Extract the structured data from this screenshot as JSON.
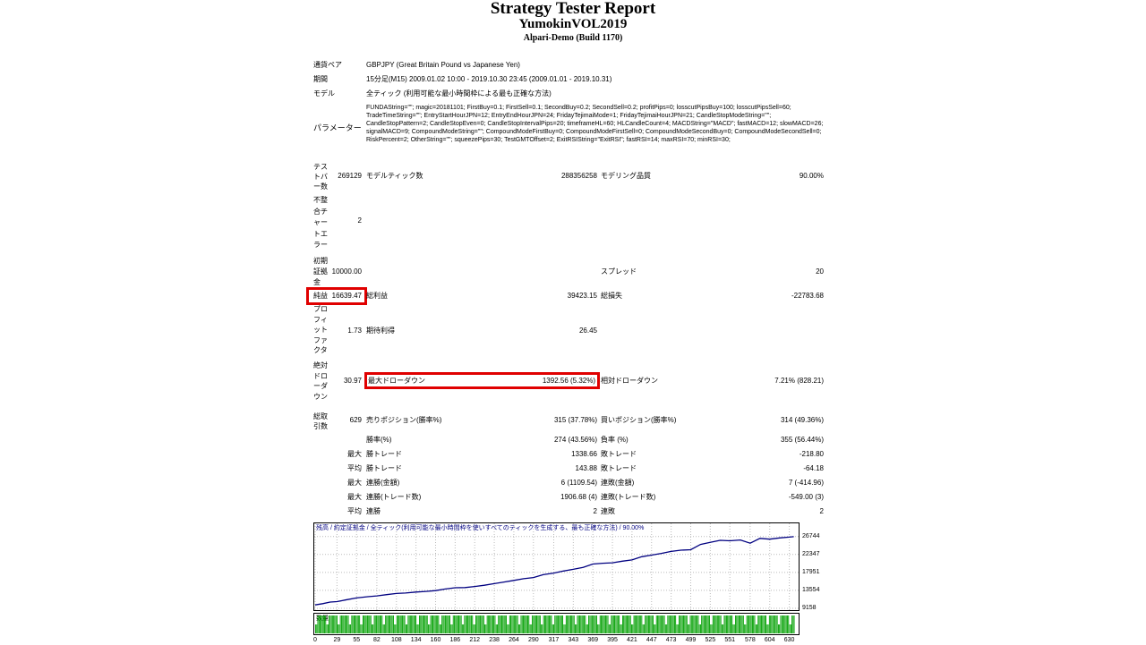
{
  "report": {
    "title": "Strategy Tester Report",
    "ea_name": "YumokinVOL2019",
    "server": "Alpari-Demo (Build 1170)"
  },
  "info": {
    "symbol_label": "通貨ペア",
    "symbol_value": "GBPJPY (Great Britain Pound vs Japanese Yen)",
    "period_label": "期間",
    "period_value": "15分足(M15) 2009.01.02 10:00 - 2019.10.30 23:45 (2009.01.01 - 2019.10.31)",
    "model_label": "モデル",
    "model_value": "全ティック (利用可能な最小時間枠による最も正確な方法)",
    "params_label": "パラメーター",
    "params_value": "FUNDAString=\"\"; magic=20181101; FirstBuy=0.1; FirstSell=0.1; SecondBuy=0.2; SecondSell=0.2; profitPips=0; losscutPipsBuy=100; losscutPipsSell=60; TradeTimeString=\"\"; EntryStartHourJPN=12; EntryEndHourJPN=24; FridayTejimaiMode=1; FridayTejimaiHourJPN=21; CandleStopModeString=\"\"; CandleStopPattern=2; CandleStopEven=0; CandleStopIntervalPips=20; timeframeHL=60; HLCandleCount=4; MACDString=\"MACD\"; fastMACD=12; slowMACD=26; signalMACD=9; CompoundModeString=\"\"; CompoundModeFirstBuy=0; CompoundModeFirstSell=0; CompoundModeSecondBuy=0; CompoundModeSecondSell=0; RiskPercent=2; OtherString=\"\"; squeezePips=30; TestGMTOffset=2; ExitRSIString=\"ExitRSI\"; fastRSI=14; maxRSI=70; minRSI=30;"
  },
  "stats": {
    "bars_label": "テストバー数",
    "bars_value": "269129",
    "ticks_label": "モデルティック数",
    "ticks_value": "288356258",
    "quality_label": "モデリング品質",
    "quality_value": "90.00%",
    "errors_label": "不整合チャートエラー",
    "errors_value": "2",
    "deposit_label": "初期証拠金",
    "deposit_value": "10000.00",
    "spread_label": "スプレッド",
    "spread_value": "20",
    "net_label": "純益",
    "net_value": "16639.47",
    "gross_profit_label": "総利益",
    "gross_profit_value": "39423.15",
    "gross_loss_label": "総損失",
    "gross_loss_value": "-22783.68",
    "pf_label": "プロフィットファクタ",
    "pf_value": "1.73",
    "expected_label": "期待利得",
    "expected_value": "26.45",
    "abs_dd_label": "絶対ドローダウン",
    "abs_dd_value": "30.97",
    "max_dd_label": "最大ドローダウン",
    "max_dd_value": "1392.56 (5.32%)",
    "rel_dd_label": "相対ドローダウン",
    "rel_dd_value": "7.21% (828.21)",
    "total_trades_label": "総取引数",
    "total_trades_value": "629",
    "short_label": "売りポジション(勝率%)",
    "short_value": "315 (37.78%)",
    "long_label": "買いポジション(勝率%)",
    "long_value": "314 (49.36%)",
    "win_rate_label": "勝率(%)",
    "win_rate_value": "274 (43.56%)",
    "loss_rate_label": "負率 (%)",
    "loss_rate_value": "355 (56.44%)",
    "max_prefix": "最大",
    "avg_prefix": "平均",
    "largest_win_label": "勝トレード",
    "largest_win_value": "1338.66",
    "largest_loss_label": "敗トレード",
    "largest_loss_value": "-218.80",
    "avg_win_label": "勝トレード",
    "avg_win_value": "143.88",
    "avg_loss_label": "敗トレード",
    "avg_loss_value": "-64.18",
    "max_consec_wins_label": "連勝(金額)",
    "max_consec_wins_value": "6 (1109.54)",
    "max_consec_losses_label": "連敗(金額)",
    "max_consec_losses_value": "7 (-414.96)",
    "max_consec_profit_label": "連勝(トレード数)",
    "max_consec_profit_value": "1906.68 (4)",
    "max_consec_loss_label": "連敗(トレード数)",
    "max_consec_loss_value": "-549.00 (3)",
    "avg_consec_wins_label": "連勝",
    "avg_consec_wins_value": "2",
    "avg_consec_losses_label": "連敗",
    "avg_consec_losses_value": "2"
  },
  "chart_data": {
    "type": "line",
    "legend_text": "残高 / 約定証拠金 / 全ティック(利用可能な最小時間枠を使いすべてのティックを生成する、最も正確な方法) / 90.00%",
    "volume_label": "数量",
    "y_ticks": [
      "26744",
      "22347",
      "17951",
      "13554",
      "9158"
    ],
    "ylim": [
      9158,
      28000
    ],
    "x_ticks": [
      "0",
      "29",
      "55",
      "82",
      "108",
      "134",
      "160",
      "186",
      "212",
      "238",
      "264",
      "290",
      "317",
      "343",
      "369",
      "395",
      "421",
      "447",
      "473",
      "499",
      "525",
      "551",
      "578",
      "604",
      "630"
    ],
    "xlim": [
      0,
      640
    ],
    "line_color": "#000080",
    "volume_color": "#00a000",
    "series": [
      {
        "x": [
          0,
          10,
          20,
          29,
          40,
          55,
          70,
          82,
          95,
          108,
          120,
          134,
          147,
          160,
          173,
          186,
          199,
          212,
          225,
          238,
          251,
          264,
          277,
          290,
          303,
          317,
          330,
          343,
          356,
          369,
          382,
          395,
          408,
          421,
          434,
          447,
          460,
          473,
          486,
          499,
          512,
          525,
          538,
          551,
          565,
          578,
          591,
          604,
          617,
          630,
          636
        ],
        "values": [
          10000,
          10300,
          10700,
          10800,
          11200,
          11700,
          12000,
          12200,
          12500,
          12800,
          12900,
          13150,
          13300,
          13500,
          13900,
          14200,
          14250,
          14500,
          14800,
          15200,
          15600,
          16000,
          16400,
          16700,
          17400,
          17800,
          18300,
          18700,
          19200,
          20000,
          20200,
          20300,
          20700,
          21000,
          21800,
          22200,
          22600,
          23100,
          23400,
          23500,
          24800,
          25300,
          25800,
          25700,
          25900,
          25100,
          26300,
          26100,
          26400,
          26600,
          26700
        ]
      }
    ]
  }
}
